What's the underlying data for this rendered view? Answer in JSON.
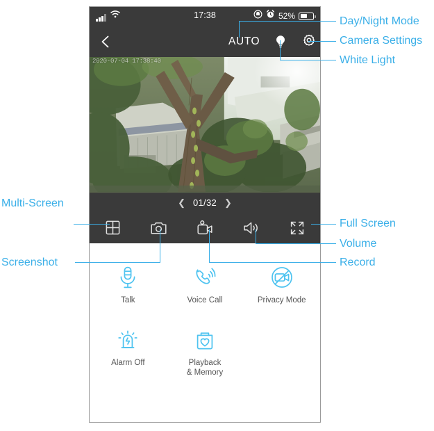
{
  "status_bar": {
    "time": "17:38",
    "battery_percent": "52%",
    "signal_icon": "cellular-signal-icon",
    "wifi_icon": "wifi-icon",
    "rotation_lock_icon": "rotation-lock-icon",
    "alarm_icon": "alarm-clock-icon",
    "battery_icon": "battery-icon"
  },
  "app_bar": {
    "back_icon": "back-chevron-icon",
    "auto_label": "AUTO",
    "white_light_icon": "lightbulb-icon",
    "settings_icon": "gear-icon"
  },
  "video": {
    "timestamp": "2020-07-04 17:38:40"
  },
  "pager": {
    "prev_icon": "chevron-left-icon",
    "count": "01/32",
    "next_icon": "chevron-right-icon"
  },
  "controls": [
    {
      "name": "multi-screen",
      "icon": "grid-icon"
    },
    {
      "name": "screenshot",
      "icon": "camera-icon"
    },
    {
      "name": "record",
      "icon": "camcorder-icon"
    },
    {
      "name": "volume",
      "icon": "speaker-icon"
    },
    {
      "name": "full-screen",
      "icon": "expand-icon"
    }
  ],
  "features": [
    [
      {
        "label": "Talk",
        "icon": "microphone-icon"
      },
      {
        "label": "Voice Call",
        "icon": "phone-call-icon"
      },
      {
        "label": "Privacy Mode",
        "icon": "camera-off-icon"
      }
    ],
    [
      {
        "label": "Alarm Off",
        "icon": "siren-icon"
      },
      {
        "label": "Playback\n& Memory",
        "icon": "sd-card-heart-icon"
      },
      {
        "label": "",
        "icon": ""
      }
    ]
  ],
  "annotations": {
    "day_night_mode": "Day/Night Mode",
    "camera_settings": "Camera Settings",
    "white_light": "White Light",
    "full_screen": "Full Screen",
    "volume": "Volume",
    "record": "Record",
    "multi_screen": "Multi-Screen",
    "screenshot": "Screenshot"
  },
  "colors": {
    "annotation": "#3aafe8",
    "feature_icon": "#4ec3f0",
    "chrome": "#3a3a3a"
  }
}
